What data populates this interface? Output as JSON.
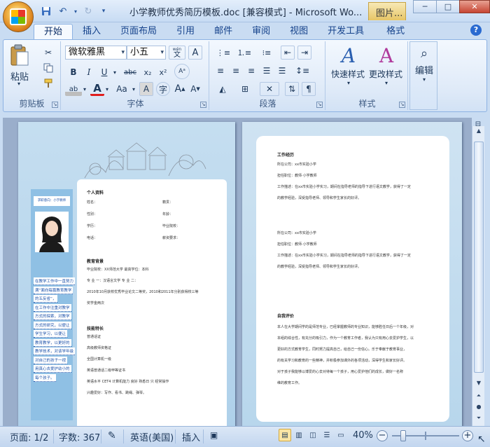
{
  "window": {
    "title": "小学教师优秀简历模板.doc [兼容模式] - Microsoft Wo...",
    "context_tab": "图片...",
    "minimize_label": "─",
    "maximize_label": "□",
    "close_label": "✕"
  },
  "tabs": [
    "开始",
    "插入",
    "页面布局",
    "引用",
    "邮件",
    "审阅",
    "视图",
    "开发工具",
    "格式"
  ],
  "active_tab": "开始",
  "ribbon": {
    "clipboard": {
      "label": "剪贴板",
      "paste_label": "粘贴"
    },
    "font": {
      "label": "字体",
      "font_name": "微软雅黑",
      "font_size": "小五",
      "wen_label": "wén"
    },
    "paragraph": {
      "label": "段落"
    },
    "styles": {
      "label": "样式",
      "quick_styles_label": "快速样式",
      "change_styles_label": "更改样式"
    },
    "editing": {
      "label": "编辑",
      "edit_label": "编辑"
    }
  },
  "document": {
    "page1": {
      "sidebar_label": "求职意向：小学教师",
      "section_personal": "个人资料",
      "personal_fields": [
        [
          "姓名：",
          "籍贯："
        ],
        [
          "性别：",
          "年龄："
        ],
        [
          "学历：",
          "毕业院校："
        ],
        [
          "电话：",
          "薪资要求："
        ]
      ],
      "section_education": "教育背景",
      "edu_lines": [
        "毕业院校：XX师范大学        最高学位：本科",
        "专 业 一：汉语言文学          专 业 二：",
        "2010年10月获校优秀毕业论文二等奖，2010和2011年分别获得校三等",
        "奖学金两次"
      ],
      "section_skills": "技能特长",
      "skill_lines": [
        "普通话证",
        "高级教师资格证",
        "全国计算机一级",
        "英语普通话二级甲等证书",
        "英语水平 CET4 计算机能力 良好 熟悉日 只 经常操作",
        "兴趣爱好：写作、看书、跳绳、弹琴。"
      ],
      "blue_notes": [
        "在教学工作中一直努力",
        "满“面向每篇教育教学",
        "的五反省”，",
        "在工作中注重对教学",
        "方式的探索，对教学",
        "方式的研究，以便让",
        "学生学习，以便让",
        "教育教学，以更好的",
        "教学技术，对该学年级",
        "对自己的孩子一视",
        "用真心去爱护幼小的",
        "每个孩子。"
      ]
    },
    "page2": {
      "section_work": "工作经历",
      "work_block_1": [
        "所在公司：xx市实验小学",
        "担任职位：教师·小学教师",
        "工作描述：在xx市实验小学实习，期间在指导老师的指导下进行语文教学，获得了一定",
        "的教学经验，深受指导老师、领导和学生家长的好评。"
      ],
      "work_block_2": [
        "所在公司：xx市实验小学",
        "担任职位：教师·小学教师",
        "工作描述：在xx市实验小学实习，期间在指导老师的指导下进行语文教学，获得了一定",
        "的教学经验，深受指导老师、领导和学生家长的好评。"
      ],
      "section_self": "自我评价",
      "self_lines": [
        "本人在大学期间学的是师范专业，已经掌握教师的专业知识，能够胜任日后一个年级，对",
        "本组的综合性，有充分的吸引力，作为一个教育工作者，我认为只有用心去爱护学生，以",
        "更好的方式教育学生，同时努力提高自己，给自己一份信心。乐于奉献于教育事业，",
        "的有关学习和教育的一些精神，并积极参加课外的各项活动，深得学生和家长好评。",
        "对于孩子我能够以博爱的心去对待每一个孩子，用心爱护他们的成长，做好一名称",
        "维的教育工作。"
      ]
    }
  },
  "status": {
    "page": "页面: 1/2",
    "words": "字数: 367",
    "language": "英语(美国)",
    "insert_mode": "插入",
    "zoom": "40%",
    "zoom_fraction": 0.4
  }
}
